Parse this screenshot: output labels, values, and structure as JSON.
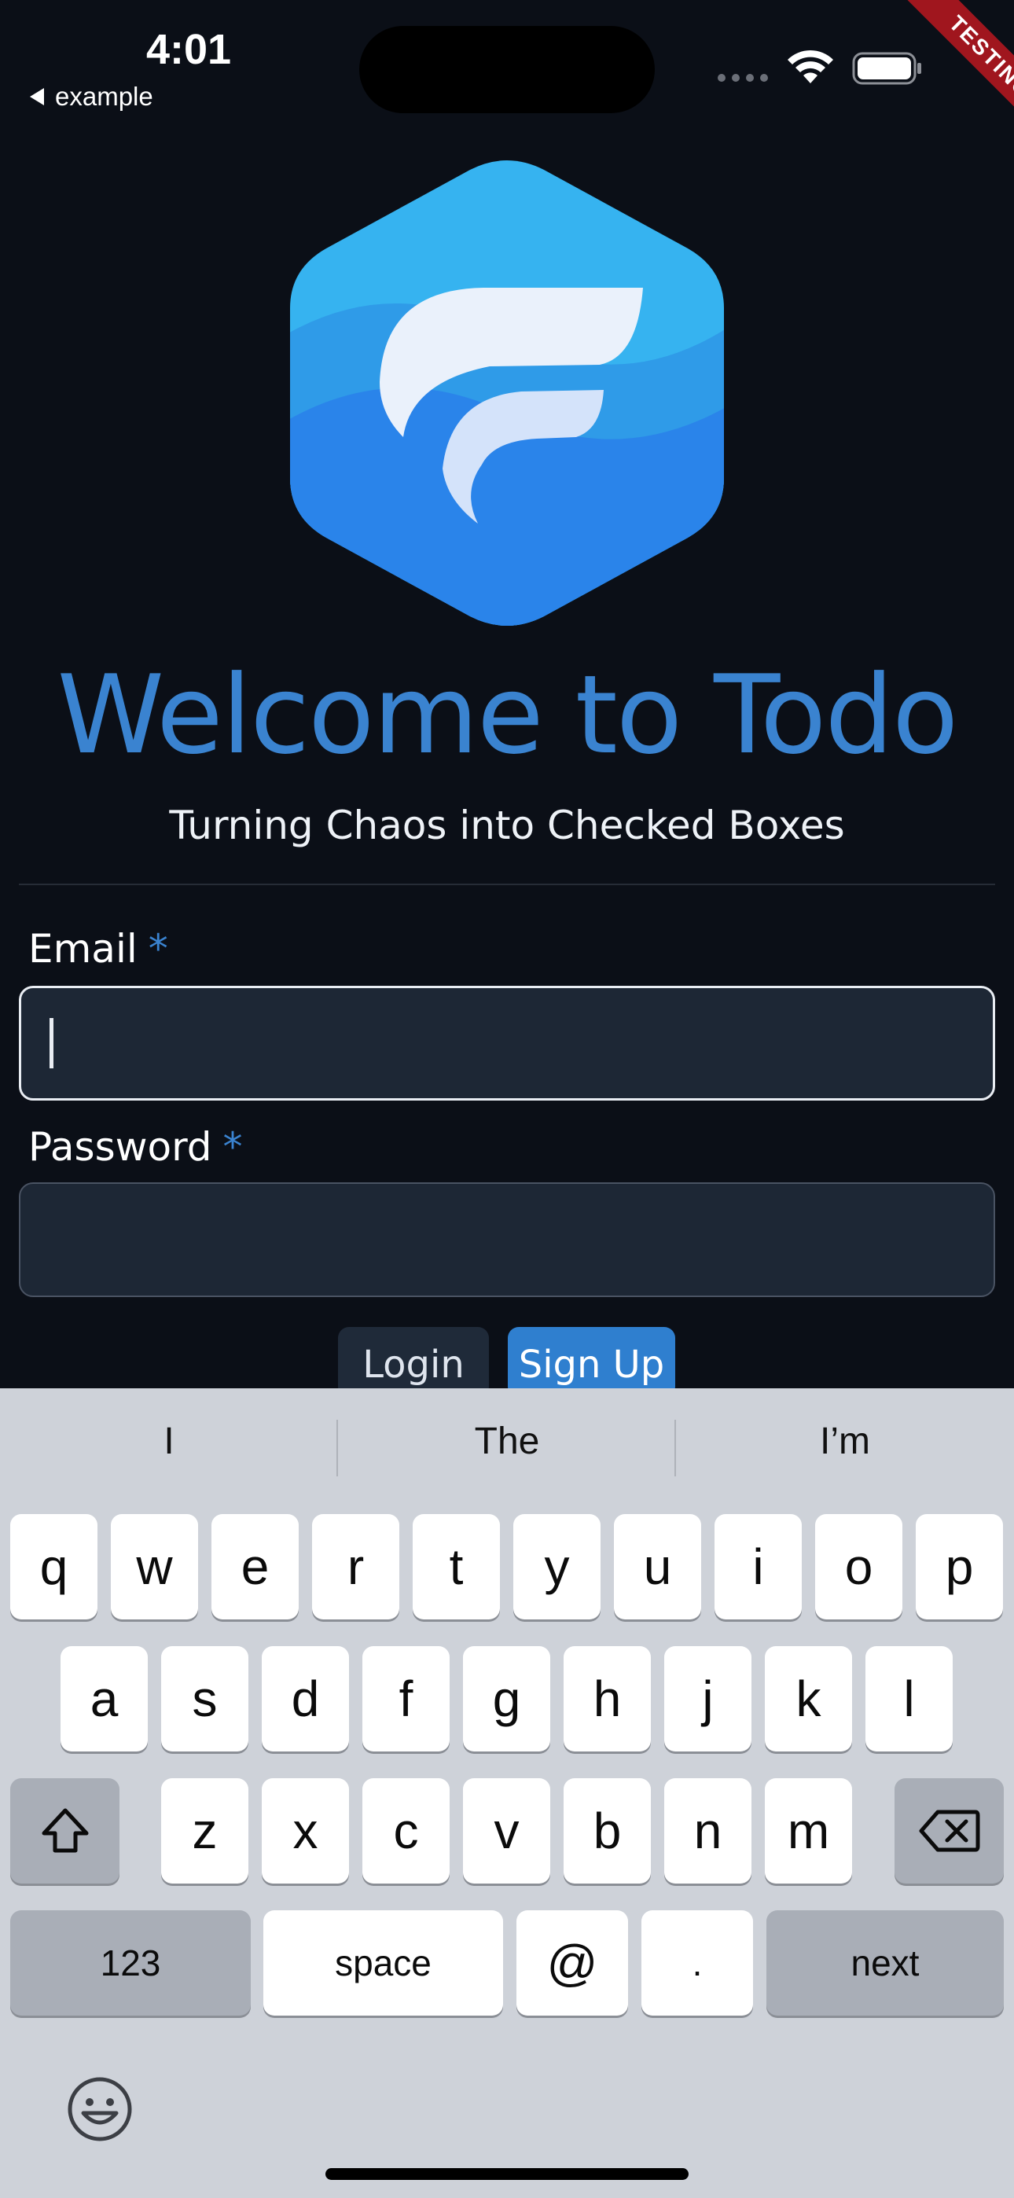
{
  "status_bar": {
    "time": "4:01",
    "back_label": "example",
    "banner": "TESTING",
    "icons": [
      "signal-icon",
      "wifi-icon",
      "battery-icon"
    ]
  },
  "app": {
    "title": "Welcome to Todo",
    "tagline": "Turning Chaos into Checked Boxes",
    "accent_color": "#3a83d0",
    "background_color": "#0b0f17"
  },
  "form": {
    "email_label": "Email",
    "password_label": "Password",
    "required_marker": "*",
    "email_value": "",
    "password_value": "",
    "login_button": "Login",
    "signup_button": "Sign Up"
  },
  "keyboard": {
    "suggestions": [
      "I",
      "The",
      "I’m"
    ],
    "row1": [
      "q",
      "w",
      "e",
      "r",
      "t",
      "y",
      "u",
      "i",
      "o",
      "p"
    ],
    "row2": [
      "a",
      "s",
      "d",
      "f",
      "g",
      "h",
      "j",
      "k",
      "l"
    ],
    "row3": [
      "z",
      "x",
      "c",
      "v",
      "b",
      "n",
      "m"
    ],
    "numbers_key": "123",
    "space_key": "space",
    "at_key": "@",
    "period_key": ".",
    "return_key": "next"
  }
}
